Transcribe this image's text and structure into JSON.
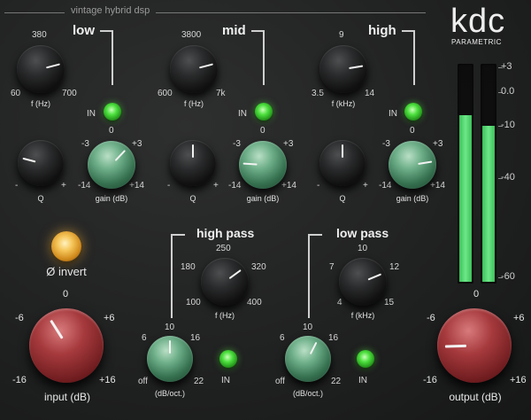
{
  "brand": {
    "logo": "kdc",
    "sub": "PARAMETRIC",
    "tagline": "vintage hybrid dsp"
  },
  "bands": [
    {
      "name": "low",
      "freq": {
        "top": "380",
        "left": "60",
        "right": "700",
        "label": "f (Hz)"
      },
      "in_label": "IN",
      "q": {
        "left": "-",
        "right": "+",
        "label": "Q"
      },
      "gain": {
        "top": "0",
        "tl": "-3",
        "tr": "+3",
        "bl": "-14",
        "br": "+14",
        "label": "gain (dB)"
      }
    },
    {
      "name": "mid",
      "freq": {
        "top": "3800",
        "left": "600",
        "right": "7k",
        "label": "f (Hz)"
      },
      "in_label": "IN",
      "q": {
        "left": "-",
        "right": "+",
        "label": "Q"
      },
      "gain": {
        "top": "0",
        "tl": "-3",
        "tr": "+3",
        "bl": "-14",
        "br": "+14",
        "label": "gain (dB)"
      }
    },
    {
      "name": "high",
      "freq": {
        "top": "9",
        "left": "3.5",
        "right": "14",
        "label": "f (kHz)"
      },
      "in_label": "IN",
      "q": {
        "left": "-",
        "right": "+",
        "label": "Q"
      },
      "gain": {
        "top": "0",
        "tl": "-3",
        "tr": "+3",
        "bl": "-14",
        "br": "+14",
        "label": "gain (dB)"
      }
    }
  ],
  "invert": {
    "label": "Ø invert"
  },
  "highpass": {
    "title": "high pass",
    "freq": {
      "top": "250",
      "tl": "180",
      "tr": "320",
      "bl": "100",
      "br": "400",
      "label": "f (Hz)"
    },
    "slope": {
      "top": "10",
      "tl": "6",
      "tr": "16",
      "bl": "off",
      "br": "22",
      "label": "(dB/oct.)"
    },
    "in_label": "IN"
  },
  "lowpass": {
    "title": "low pass",
    "freq": {
      "top": "10",
      "tl": "7",
      "tr": "12",
      "bl": "4",
      "br": "15",
      "label": "f (kHz)"
    },
    "slope": {
      "top": "10",
      "tl": "6",
      "tr": "16",
      "bl": "off",
      "br": "22",
      "label": "(dB/oct.)"
    },
    "in_label": "IN"
  },
  "input": {
    "top": "0",
    "tl": "-6",
    "tr": "+6",
    "bl": "-16",
    "br": "+16",
    "label": "input (dB)"
  },
  "output": {
    "top": "0",
    "tl": "-6",
    "tr": "+6",
    "bl": "-16",
    "br": "+16",
    "label": "output (dB)"
  },
  "meter": {
    "scale": [
      "+3",
      "0.0",
      "-10",
      "-40",
      "-60"
    ],
    "levels": [
      0.76,
      0.71
    ]
  },
  "colors": {
    "accent_green": "#4bdf3d",
    "knob_green": "#5fa67c",
    "knob_red": "#a63a3d",
    "meter": "#5fd97a",
    "amber": "#f6c65a"
  },
  "knobs": {
    "low_freq": 0.78,
    "low_q": 0.22,
    "low_gain": 0.66,
    "mid_freq": 0.78,
    "mid_q": 0.5,
    "mid_gain": 0.18,
    "high_freq": 0.8,
    "high_q": 0.5,
    "high_gain": 0.8,
    "hp_freq": 0.7,
    "hp_slope": 0.5,
    "lp_freq": 0.75,
    "lp_slope": 0.6,
    "input": 0.38,
    "output": 0.16
  }
}
